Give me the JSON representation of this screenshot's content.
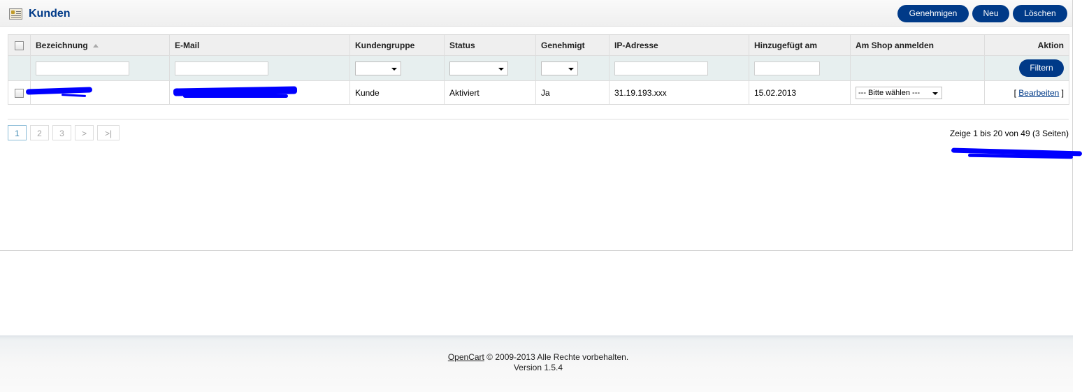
{
  "header": {
    "title": "Kunden",
    "buttons": {
      "approve": "Genehmigen",
      "new": "Neu",
      "delete": "Löschen"
    }
  },
  "table": {
    "columns": [
      "Bezeichnung",
      "E-Mail",
      "Kundengruppe",
      "Status",
      "Genehmigt",
      "IP-Adresse",
      "Hinzugefügt am",
      "Am Shop anmelden",
      "Aktion"
    ],
    "filter_button": "Filtern",
    "rows": [
      {
        "name": "",
        "email": "",
        "group": "Kunde",
        "status": "Aktiviert",
        "approved": "Ja",
        "ip": "31.19.193.xxx",
        "date_added": "15.02.2013",
        "login_select": "--- Bitte wählen ---",
        "action_open": "[ ",
        "action_label": "Bearbeiten",
        "action_close": " ]"
      }
    ]
  },
  "pagination": {
    "pages": [
      "1",
      "2",
      "3",
      ">",
      ">|"
    ],
    "active_page": "1",
    "info": "Zeige 1 bis 20 von 49 (3 Seiten)"
  },
  "footer": {
    "link": "OpenCart",
    "copyright": " © 2009-2013 Alle Rechte vorbehalten.",
    "version": "Version 1.5.4"
  },
  "colors": {
    "accent": "#003a88",
    "redaction": "#0000ff"
  }
}
